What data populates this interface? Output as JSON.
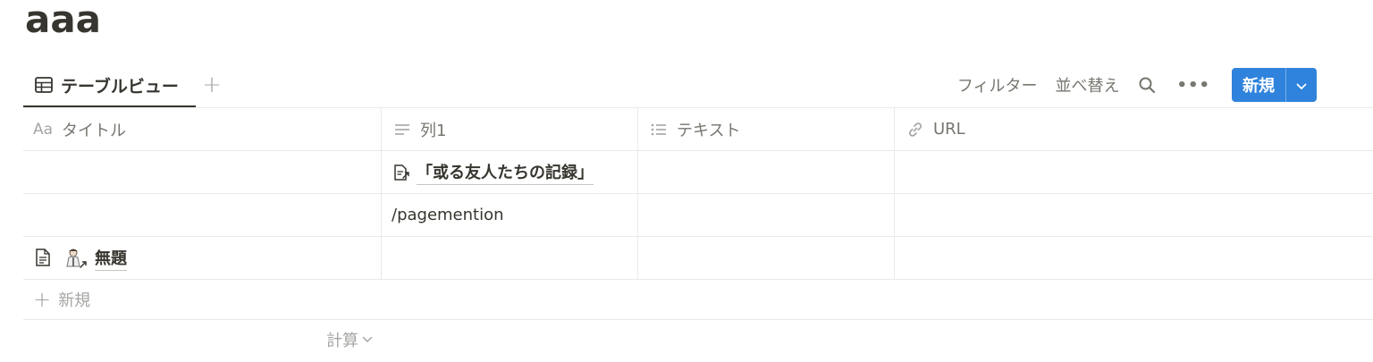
{
  "page": {
    "title": "aaa"
  },
  "view_bar": {
    "tab_label": "テーブルビュー",
    "tab_icon": "table-icon",
    "add_view_icon": "plus-icon",
    "add_view_glyph": "+",
    "toolbar": {
      "filter_label": "フィルター",
      "sort_label": "並べ替え",
      "search_icon": "search-icon",
      "more_icon": "more-icon",
      "more_glyph": "•••",
      "new_label": "新規",
      "new_dropdown_icon": "chevron-down-icon"
    }
  },
  "table": {
    "columns": [
      {
        "icon": "aa-icon",
        "icon_text": "Aa",
        "label": "タイトル"
      },
      {
        "icon": "text-lines-icon",
        "label": "列1"
      },
      {
        "icon": "list-icon",
        "label": "テキスト"
      },
      {
        "icon": "link-icon",
        "label": "URL"
      }
    ],
    "rows": [
      {
        "title": "",
        "col1_mention": "「或る友人たちの記録」",
        "text": "",
        "url": ""
      },
      {
        "title": "",
        "col1": "/pagemention",
        "text": "",
        "url": ""
      },
      {
        "title": "無題",
        "title_icon": "page-icon",
        "title_mention_icon": "person-emoji-icon",
        "col1": "",
        "text": "",
        "url": ""
      }
    ],
    "new_row_label": "新規",
    "calc_label": "計算"
  },
  "colors": {
    "text": "#37352f",
    "muted": "#77766f",
    "faint": "#a5a5a3",
    "border": "#e9e9e7",
    "accent": "#2f83dc"
  }
}
